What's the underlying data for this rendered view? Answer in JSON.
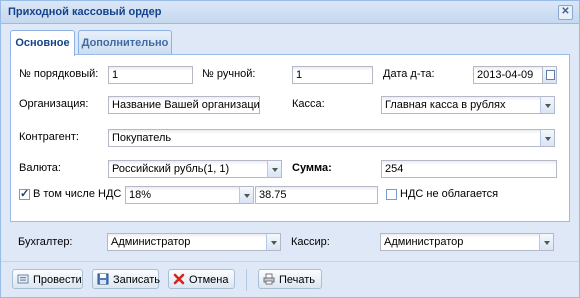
{
  "window": {
    "title": "Приходной кассовый ордер"
  },
  "tabs": [
    {
      "label": "Основное",
      "active": true
    },
    {
      "label": "Дополнительно",
      "active": false
    }
  ],
  "form": {
    "order_no_label": "№ порядковый:",
    "order_no_value": "1",
    "manual_no_label": "№ ручной:",
    "manual_no_value": "1",
    "date_label": "Дата д-та:",
    "date_value": "2013-04-09",
    "org_label": "Организация:",
    "org_value": "Название Вашей организации",
    "cash_label": "Касса:",
    "cash_value": "Главная касса в рублях",
    "counterparty_label": "Контрагент:",
    "counterparty_value": "Покупатель",
    "currency_label": "Валюта:",
    "currency_value": "Российский рубль(1, 1)",
    "sum_label": "Сумма:",
    "sum_value": "254",
    "vat_checkbox_label": "В том числе НДС",
    "vat_checked": true,
    "vat_rate_value": "18%",
    "vat_amount_value": "38.75",
    "no_vat_label": "НДС не облагается",
    "no_vat_checked": false
  },
  "bottom": {
    "accountant_label": "Бухгалтер:",
    "accountant_value": "Администратор",
    "cashier_label": "Кассир:",
    "cashier_value": "Администратор"
  },
  "toolbar": {
    "post_label": "Провести",
    "save_label": "Записать",
    "cancel_label": "Отмена",
    "print_label": "Печать"
  },
  "colors": {
    "accent": "#15428b",
    "border": "#99bbe8",
    "background": "#dfe8f6"
  }
}
